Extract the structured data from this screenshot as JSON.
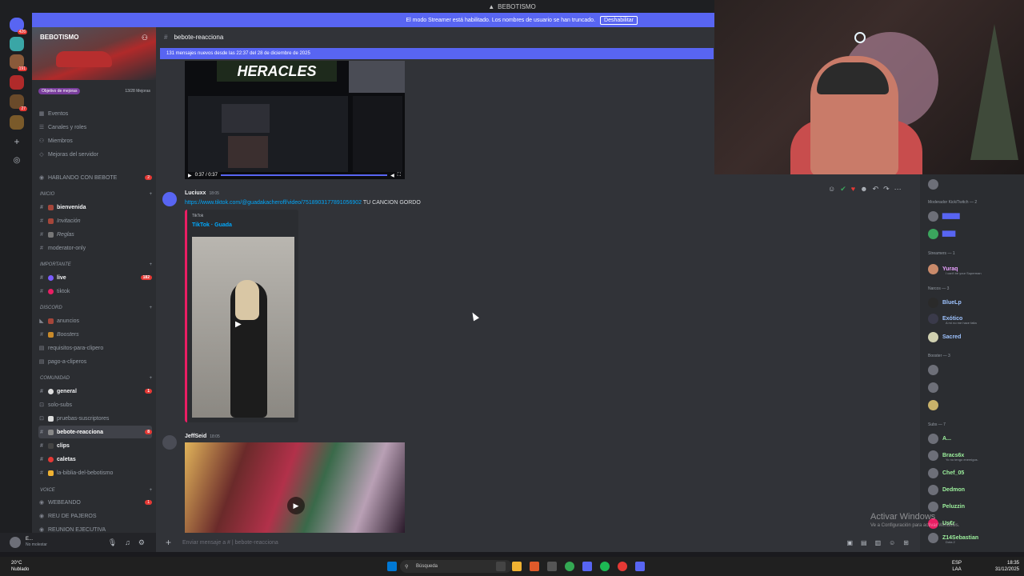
{
  "titlebar": {
    "title": "BEBOTISMO"
  },
  "streamer_banner": {
    "text": "El modo Streamer está habilitado. Los nombres de usuario se han truncado.",
    "button": "Deshabilitar"
  },
  "server": {
    "name": "BEBOTISMO",
    "boost_goal": "Objetivo de mejoras",
    "boost_count": "13/28 Mejoras"
  },
  "rail_badges": [
    "426",
    "191",
    "27"
  ],
  "menu": [
    "Eventos",
    "Canales y roles",
    "Miembros",
    "Mejoras del servidor"
  ],
  "channels": [
    {
      "label": "HABLANDO CON BEBOTE",
      "count": "2"
    },
    {
      "category": "INICIO"
    },
    {
      "label": "bienvenida"
    },
    {
      "label": "Invitación"
    },
    {
      "label": "Reglas"
    },
    {
      "label": "moderator-only"
    },
    {
      "category": "IMPORTANTE"
    },
    {
      "label": "live",
      "count": "182"
    },
    {
      "label": "tiktok"
    },
    {
      "category": "DISCORD"
    },
    {
      "label": "anuncios"
    },
    {
      "label": "Boosters"
    },
    {
      "label": "requisitos-para-clipero"
    },
    {
      "label": "pago-a-cliperos"
    },
    {
      "category": "COMUNIDAD"
    },
    {
      "label": "general",
      "count": "1"
    },
    {
      "label": "solo-subs"
    },
    {
      "label": "pruebas-suscriptores"
    },
    {
      "label": "bebote-reacciona",
      "count": "8"
    },
    {
      "label": "clips"
    },
    {
      "label": "caletas"
    },
    {
      "label": "la-biblia-del-bebotismo"
    },
    {
      "category": "VOICE"
    },
    {
      "label": "WEBEANDO",
      "count": "1"
    },
    {
      "label": "REU DE PAJEROS"
    },
    {
      "label": "REUNION EJECUTIVA"
    }
  ],
  "user_panel": {
    "name": "E...",
    "status": "No molestar"
  },
  "chat": {
    "channel": "bebote-reacciona",
    "new_messages": "131 mensajes nuevos desde las 22:37 del 28 de diciembre de 2025",
    "video1": {
      "banner": "HERACLES",
      "time": "0:37 / 0:37"
    },
    "messages": [
      {
        "author": "Luciuxx",
        "time": "18:05",
        "link": "https://www.tiktok.com/@guadakacheroff/video/7518903177891056902",
        "text": "TU CANCION GORDO",
        "embed_provider": "TikTok",
        "embed_title": "TikTok · Guada"
      },
      {
        "author": "JeffSeid",
        "time": "18:05"
      }
    ],
    "composer_placeholder": "Enviar mensaje a #",
    "composer_channel": "bebote-reacciona"
  },
  "members": {
    "sections": [
      {
        "head": "Moderador Kick/Twitch — 2"
      },
      {
        "head": "Streamers — 1"
      },
      {
        "head": "Narcos — 3"
      },
      {
        "head": "Booster — 3"
      },
      {
        "head": "Subs — 7"
      }
    ],
    "list": [
      {
        "name": "Yuraq",
        "sub": "I can't be your Superman",
        "color": "#e9a1ff"
      },
      {
        "name": "BlueLp",
        "color": "#9ec3ff"
      },
      {
        "name": "Exótico",
        "sub": "A mí no me hace falta",
        "color": "#9ec3ff"
      },
      {
        "name": "Sacred",
        "color": "#9ec3ff"
      },
      {
        "name": "A...",
        "color": "#9ef29e"
      },
      {
        "name": "Bracs6x",
        "sub": "Yo no tengo enemigos.",
        "color": "#9ef29e"
      },
      {
        "name": "Chef_05",
        "color": "#9ef29e"
      },
      {
        "name": "Dedmon",
        "color": "#9ef29e"
      },
      {
        "name": "Peluzzin",
        "color": "#9ef29e"
      },
      {
        "name": "Us€r",
        "color": "#9ef29e"
      },
      {
        "name": "Z14Sebastian",
        "sub": "Dota 2",
        "color": "#9ef29e"
      }
    ]
  },
  "watermark": {
    "title": "Activar Windows",
    "sub": "Ve a Configuración para activar Windows."
  },
  "taskbar": {
    "temp": "20°C",
    "weather": "Nublado",
    "search": "Búsqueda",
    "lang1": "ESP",
    "lang2": "LAA",
    "time": "18:35",
    "date": "31/12/2025"
  }
}
